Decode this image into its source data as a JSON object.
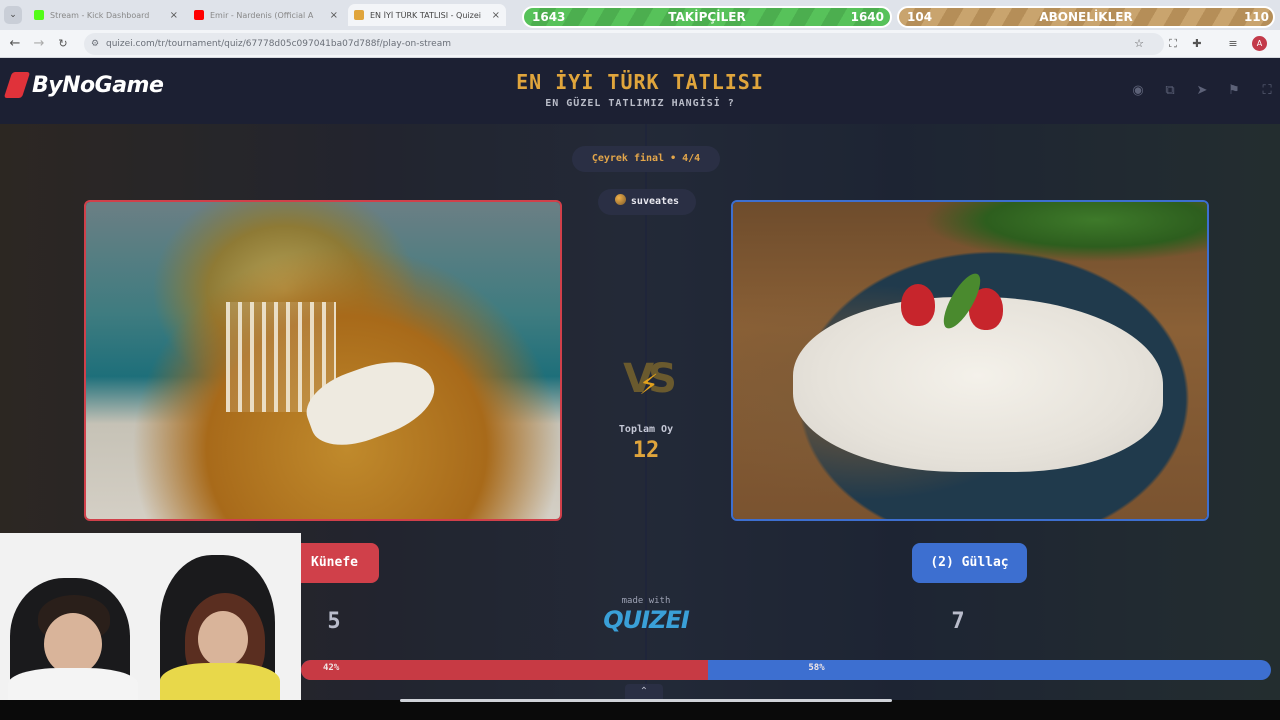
{
  "browser": {
    "tabs": [
      {
        "title": "Stream - Kick Dashboard",
        "active": false,
        "favicon_color": "#53fc18"
      },
      {
        "title": "Emir - Nardenis (Official A",
        "active": false,
        "favicon_color": "#ff0000"
      },
      {
        "title": "EN İYİ TÜRK TATLISI - Quizei",
        "active": true,
        "favicon_color": "#e0a53c"
      }
    ],
    "url": "quizei.com/tr/tournament/quiz/67778d05c097041ba07d788f/play-on-stream"
  },
  "overlay": {
    "followers": {
      "left_value": "1643",
      "title": "TAKİPÇİLER",
      "right_value": "1640"
    },
    "subscribers": {
      "left_value": "104",
      "title": "ABONELİKLER",
      "right_value": "110"
    }
  },
  "site": {
    "logo_text": "ByNoGame",
    "title": "EN İYİ TÜRK TATLISI",
    "subtitle": "EN GÜZEL TATLIMIZ HANGİSİ ?",
    "header_icons": [
      "eye-icon",
      "share-icon",
      "send-icon",
      "flag-icon",
      "fullscreen-icon"
    ]
  },
  "match": {
    "round": "Çeyrek final • 4/4",
    "user": "suveates",
    "total_label": "Toplam Oy",
    "total_value": "12",
    "left": {
      "label": "Künefe",
      "votes": "5",
      "percent": "42%",
      "share": 0.42,
      "color": "#d0404a"
    },
    "right": {
      "label": "(2) Güllaç",
      "votes": "7",
      "percent": "58%",
      "share": 0.58,
      "color": "#3d6fd0"
    }
  },
  "footer": {
    "made_with": "made with",
    "brand": "QUIZEI"
  }
}
